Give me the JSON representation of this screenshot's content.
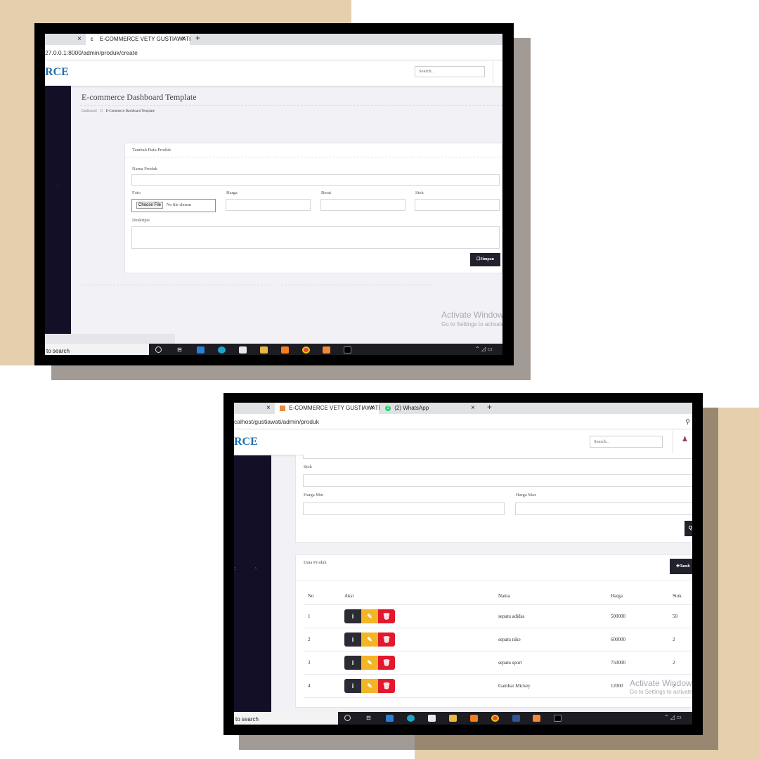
{
  "screen1": {
    "tabs": [
      {
        "label": "",
        "close": "×"
      },
      {
        "icon": "ɛ",
        "label": "E-COMMERCE VETY GUSTIAWATI",
        "close": "×"
      }
    ],
    "new_tab": "+",
    "url": "27.0.0.1:8000/admin/produk/create",
    "brand": "RCE",
    "search_placeholder": "Search..",
    "page_title": "E-commerce Dashboard Template",
    "breadcrumb": [
      "Dashboard",
      "E-Commerce Dashboard Template"
    ],
    "breadcrumb_sep": "☐",
    "sidebar_dot": "·",
    "form": {
      "title": "Tambah Data Produk",
      "nama_label": "Nama Produk",
      "foto_label": "Foto",
      "choose_file": "Choose File",
      "no_file": "No file chosen",
      "harga_label": "Harga",
      "berat_label": "Berat",
      "stok_label": "Stok",
      "deskripsi_label": "Deskripsi",
      "save_button": "☐Simpan"
    },
    "watermark": {
      "line1": "Activate Windows",
      "line2": "Go to Settings to activate Windows."
    },
    "taskbar": {
      "search": "to search"
    }
  },
  "screen2": {
    "tabs": [
      {
        "label": "",
        "close": "×"
      },
      {
        "label": "E-COMMERCE VETY GUSTIAWATI",
        "close": "×"
      },
      {
        "label": "(2) WhatsApp",
        "badge": "2",
        "close": "×"
      }
    ],
    "new_tab": "+",
    "url": "calhost/gustiawati/admin/produk",
    "brand": "RCE",
    "search_placeholder": "Search..",
    "sidebar_marks": [
      "::",
      "›"
    ],
    "filter": {
      "stok_label": "Stok",
      "harga_min_label": "Harga Min",
      "harga_max_label": "Harga Max",
      "filter_button_icon": "Q"
    },
    "data_card": {
      "title": "Data Produk",
      "add_button": "✚Tamb",
      "columns": [
        "No",
        "Aksi",
        "Nama",
        "Harga",
        "Stok"
      ],
      "rows": [
        {
          "no": "1",
          "nama": "sepatu adidas",
          "harga": "500000",
          "stok": "50"
        },
        {
          "no": "2",
          "nama": "sepatu nike",
          "harga": "600000",
          "stok": "2"
        },
        {
          "no": "3",
          "nama": "sepatu sport",
          "harga": "750000",
          "stok": "2"
        },
        {
          "no": "4",
          "nama": "Gambar Mickey",
          "harga": "12000",
          "stok": "2"
        }
      ],
      "action_icons": {
        "info": "i",
        "edit": "✎",
        "delete": "🗑"
      }
    },
    "watermark": {
      "line1": "Activate Windows",
      "line2": "Go to Settings to activate Windows."
    },
    "taskbar": {
      "search": "to search"
    }
  },
  "colors": {
    "accent_brand": "#1e6fb4",
    "sidebar": "#120f26",
    "btn_dark": "#22222e",
    "btn_edit": "#f2b526",
    "btn_delete": "#e3182d",
    "bg_beige": "#e6cfad"
  },
  "icons": [
    "cortana-circle-icon",
    "task-view-icon",
    "mail-icon",
    "edge-icon",
    "store-icon",
    "file-explorer-icon",
    "sublime-icon",
    "chrome-icon",
    "word-icon",
    "xampp-icon",
    "terminal-icon"
  ]
}
